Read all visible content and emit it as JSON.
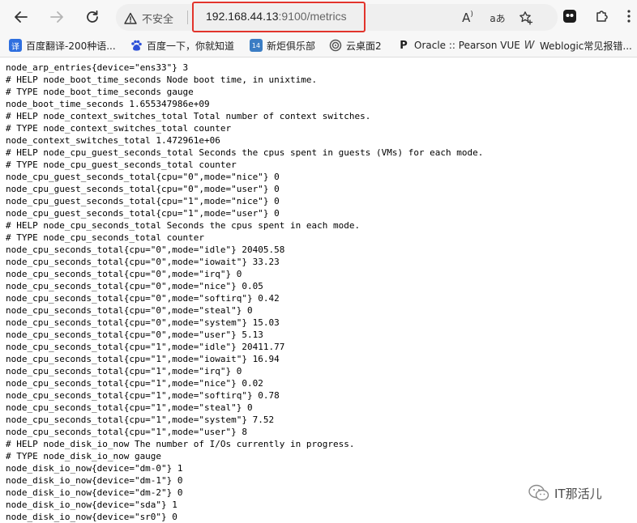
{
  "address_bar": {
    "security_label": "不安全",
    "url_host": "192.168.44.13",
    "url_rest": ":9100/metrics"
  },
  "toolbar": {
    "read_aloud_label": "A",
    "translate_label": "aあ"
  },
  "bookmarks": [
    {
      "label": "百度翻译-200种语...",
      "icon": "translate-icon",
      "icon_text": "译",
      "color": "#2f6fdf"
    },
    {
      "label": "百度一下，你就知道",
      "icon": "baidu-icon",
      "icon_text": "",
      "color": "#2e51d8"
    },
    {
      "label": "新炬俱乐部",
      "icon": "club-icon",
      "icon_text": "14",
      "color": "#3b7dc4"
    },
    {
      "label": "云桌面2",
      "icon": "cloud-desktop-icon",
      "icon_text": "",
      "color": "#666666"
    },
    {
      "label": "Oracle :: Pearson VUE",
      "icon": "pearson-icon",
      "icon_text": "P",
      "color": "#1d1d1d"
    },
    {
      "label": "Weblogic常见报错...",
      "icon": "weblogic-icon",
      "icon_text": "W",
      "color": "#444444"
    }
  ],
  "metrics_lines": [
    "node_arp_entries{device=\"ens33\"} 3",
    "# HELP node_boot_time_seconds Node boot time, in unixtime.",
    "# TYPE node_boot_time_seconds gauge",
    "node_boot_time_seconds 1.655347986e+09",
    "# HELP node_context_switches_total Total number of context switches.",
    "# TYPE node_context_switches_total counter",
    "node_context_switches_total 1.472961e+06",
    "# HELP node_cpu_guest_seconds_total Seconds the cpus spent in guests (VMs) for each mode.",
    "# TYPE node_cpu_guest_seconds_total counter",
    "node_cpu_guest_seconds_total{cpu=\"0\",mode=\"nice\"} 0",
    "node_cpu_guest_seconds_total{cpu=\"0\",mode=\"user\"} 0",
    "node_cpu_guest_seconds_total{cpu=\"1\",mode=\"nice\"} 0",
    "node_cpu_guest_seconds_total{cpu=\"1\",mode=\"user\"} 0",
    "# HELP node_cpu_seconds_total Seconds the cpus spent in each mode.",
    "# TYPE node_cpu_seconds_total counter",
    "node_cpu_seconds_total{cpu=\"0\",mode=\"idle\"} 20405.58",
    "node_cpu_seconds_total{cpu=\"0\",mode=\"iowait\"} 33.23",
    "node_cpu_seconds_total{cpu=\"0\",mode=\"irq\"} 0",
    "node_cpu_seconds_total{cpu=\"0\",mode=\"nice\"} 0.05",
    "node_cpu_seconds_total{cpu=\"0\",mode=\"softirq\"} 0.42",
    "node_cpu_seconds_total{cpu=\"0\",mode=\"steal\"} 0",
    "node_cpu_seconds_total{cpu=\"0\",mode=\"system\"} 15.03",
    "node_cpu_seconds_total{cpu=\"0\",mode=\"user\"} 5.13",
    "node_cpu_seconds_total{cpu=\"1\",mode=\"idle\"} 20411.77",
    "node_cpu_seconds_total{cpu=\"1\",mode=\"iowait\"} 16.94",
    "node_cpu_seconds_total{cpu=\"1\",mode=\"irq\"} 0",
    "node_cpu_seconds_total{cpu=\"1\",mode=\"nice\"} 0.02",
    "node_cpu_seconds_total{cpu=\"1\",mode=\"softirq\"} 0.78",
    "node_cpu_seconds_total{cpu=\"1\",mode=\"steal\"} 0",
    "node_cpu_seconds_total{cpu=\"1\",mode=\"system\"} 7.52",
    "node_cpu_seconds_total{cpu=\"1\",mode=\"user\"} 8",
    "# HELP node_disk_io_now The number of I/Os currently in progress.",
    "# TYPE node_disk_io_now gauge",
    "node_disk_io_now{device=\"dm-0\"} 1",
    "node_disk_io_now{device=\"dm-1\"} 0",
    "node_disk_io_now{device=\"dm-2\"} 0",
    "node_disk_io_now{device=\"sda\"} 1",
    "node_disk_io_now{device=\"sr0\"} 0"
  ],
  "watermark": {
    "text": "IT那活儿",
    "icon": "wechat-icon"
  }
}
